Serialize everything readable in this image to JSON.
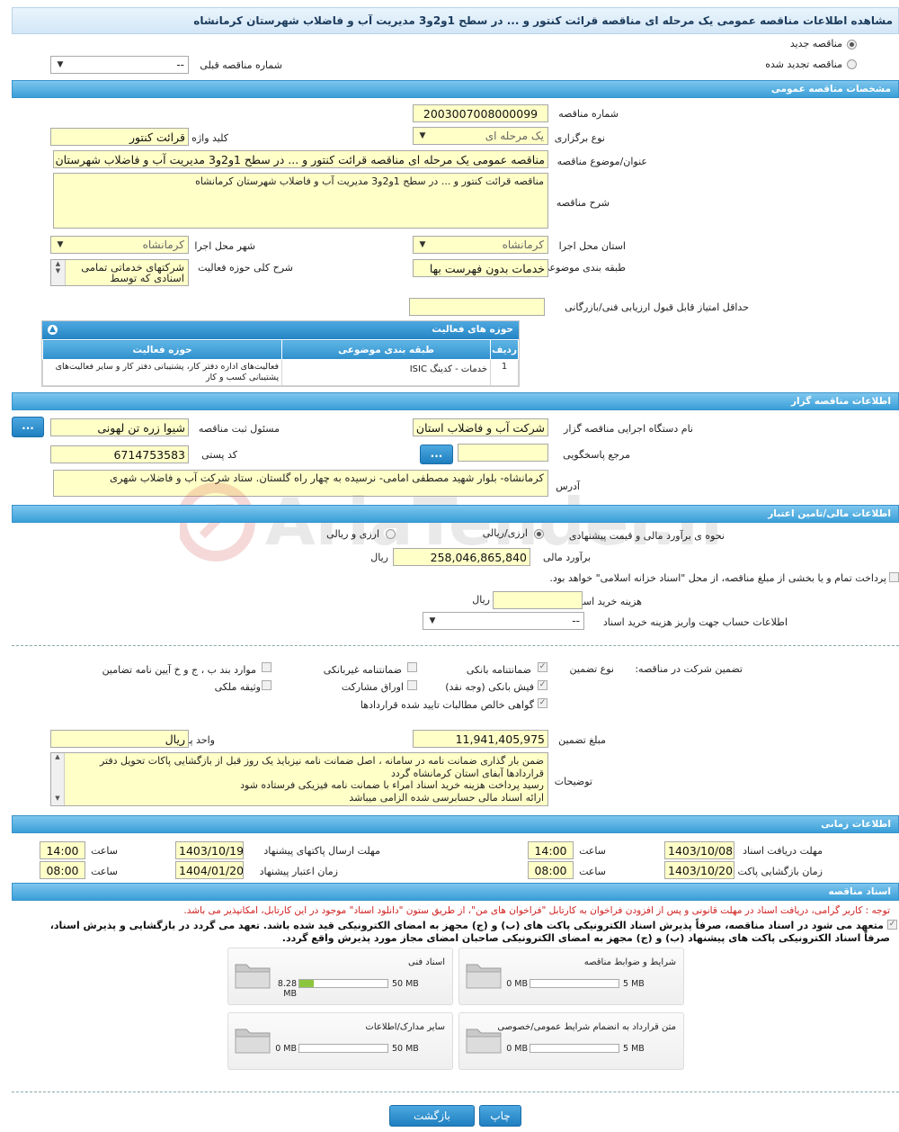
{
  "header": {
    "title": "مشاهده اطلاعات مناقصه عمومی یک مرحله ای مناقصه قرائت کنتور و ... در سطح 1و2و3 مدیریت آب و فاضلاب شهرستان کرمانشاه"
  },
  "top": {
    "radio_new": "مناقصه جدید",
    "radio_renew": "مناقصه تجدید شده",
    "prev_number_label": "شماره مناقصه قبلی",
    "prev_number_value": "--"
  },
  "sections": {
    "general": "مشخصات مناقصه عمومی",
    "organizer": "اطلاعات مناقصه گزار",
    "financial": "اطلاعات مالی/تامین اعتبار",
    "timing": "اطلاعات زمانی",
    "documents": "اسناد مناقصه"
  },
  "general": {
    "number_label": "شماره مناقصه",
    "number_value": "2003007008000099",
    "hold_type_label": "نوع برگزاری",
    "hold_type_value": "یک مرحله ای",
    "keyword_label": "کلید واژه",
    "keyword_value": "قرائت کنتور",
    "subject_label": "عنوان/موضوع مناقصه",
    "subject_value": "مناقصه عمومی یک مرحله ای مناقصه قرائت کنتور و ... در سطح 1و2و3 مدیریت آب و فاضلاب شهرستان کرمانشاه",
    "description_label": "شرح مناقصه",
    "description_value": "مناقصه قرائت کنتور و ... در سطح 1و2و3 مدیریت آب و فاضلاب شهرستان کرمانشاه",
    "province_label": "استان محل اجرا",
    "province_value": "کرمانشاه",
    "city_label": "شهر محل اجرا",
    "city_value": "کرمانشاه",
    "category_label": "طبقه بندی موضوعی",
    "category_value": "خدمات بدون فهرست بها",
    "activity_desc_label": "شرح کلی حوزه فعالیت",
    "activity_desc_value": "شرکتهای خدماتی تمامی اسنادی که توسط",
    "min_score_label": "حداقل امتیاز قابل قبول ارزیابی فنی/بازرگانی",
    "min_score_value": ""
  },
  "activity_table": {
    "title": "حوزه های فعالیت",
    "headers": [
      "ردیف",
      "طبقه بندی موضوعی",
      "حوزه فعالیت"
    ],
    "rows": [
      [
        "1",
        "خدمات - کدینگ ISIC",
        "فعالیت‌های  اداره دفتر کار، پشتیبانی دفتر کار و سایر فعالیت‌های پشتیبانی کسب و کار"
      ]
    ]
  },
  "organizer": {
    "agency_label": "نام دستگاه اجرایی مناقصه گزار",
    "agency_value": "شرکت آب و فاضلاب استان",
    "registrar_label": "مسئول ثبت مناقصه",
    "registrar_value": "شیوا زره تن لهونی",
    "more_button": "...",
    "responder_label": "مرجع پاسخگویی",
    "responder_value": "",
    "postal_label": "کد پستی",
    "postal_value": "6714753583",
    "address_label": "آدرس",
    "address_value": "کرمانشاه- بلوار شهید مصطفی امامی- نرسیده به چهار راه گلستان. ستاد شرکت  آب و فاضلاب شهری"
  },
  "financial": {
    "estimate_method_label": "نحوه ی برآورد مالی و قیمت پیشنهادی",
    "opt_rial_currency": "ارزی/ریالی",
    "opt_currency_and_rial": "ارزی و ریالی",
    "estimate_label": "برآورد مالی",
    "estimate_value": "258,046,865,840",
    "currency_rial": "ریال",
    "treasury_text": "پرداخت تمام و یا بخشی از مبلغ مناقصه، از محل \"اسناد خزانه اسلامی\" خواهد بود.",
    "doc_fee_label": "هزینه خرید اسناد",
    "doc_fee_value": "",
    "account_label": "اطلاعات حساب جهت واریز هزینه خرید اسناد",
    "account_value": "--",
    "guarantee_section_label": "تضمین شرکت در مناقصه:",
    "guarantee_type_label": "نوع تضمین",
    "guarantees": [
      {
        "label": "ضمانتنامه بانکی",
        "checked": true
      },
      {
        "label": "ضمانتنامه غیربانکی",
        "checked": false
      },
      {
        "label": "موارد بند ب ، ج و خ آیین نامه تضامین",
        "checked": false
      },
      {
        "label": "فیش بانکی (وجه نقد)",
        "checked": true
      },
      {
        "label": "اوراق مشارکت",
        "checked": false
      },
      {
        "label": "وثیقه ملکی",
        "checked": false
      },
      {
        "label": "گواهی خالص مطالبات تایید شده قراردادها",
        "checked": true
      }
    ],
    "guarantee_amount_label": "مبلغ تضمین",
    "guarantee_amount_value": "11,941,405,975",
    "money_unit_label": "واحد پول",
    "money_unit_value": "ریال",
    "notes_label": "توضیحات",
    "notes_lines": [
      "ضمن بار گذاری ضمانت نامه در سامانه ، اصل ضمانت نامه نیزبایذ یک روز قبل از بازگشایی پاکات تحویل دفتر قراردادها آبفای استان کرمانشاه گردد",
      " رسید پرداخت هزینه خرید اسناد امراء با ضمانت نامه فیزیکی فرستاده شود",
      "ارائه اسناد مالی حسابرسی شده الزامی میباشد"
    ]
  },
  "timing": {
    "doc_receive_deadline_label": "مهلت دریافت اسناد",
    "doc_receive_deadline_date": "1403/10/08",
    "doc_receive_deadline_time": "14:00",
    "submit_deadline_label": "مهلت ارسال پاکتهای پیشنهاد",
    "submit_deadline_date": "1403/10/19",
    "submit_deadline_time": "14:00",
    "opening_label": "زمان بازگشایی پاکت ها",
    "opening_date": "1403/10/20",
    "opening_time": "08:00",
    "validity_label": "زمان اعتبار پیشنهاد",
    "validity_date": "1404/01/20",
    "validity_time": "08:00",
    "time_label": "ساعت"
  },
  "documents": {
    "red_notice": "توجه : کاربر گرامی، دریافت اسناد در مهلت قانونی و پس از افزودن فراخوان به کارتابل \"فراخوان های من\"، از طریق ستون \"دانلود اسناد\" موجود در این کارتابل، امکانپذیر می باشد.",
    "commitment_line1": "متعهد می شود در اسناد مناقصه، صرفاً پذیرش اسناد الکترونیکی پاکت های (ب) و (ج) مجهز به امضای الکترونیکی قید شده باشد. تعهد می گردد در بازگشایی و پذیرش اسناد،",
    "commitment_line2": "صرفاً اسناد الکترونیکی پاکت های پیشنهاد (ب) و (ج) مجهز به امضای الکترونیکی صاحبان امضای مجاز مورد پذیرش واقع گردد.",
    "files": [
      {
        "name": "شرایط و ضوابط مناقصه",
        "min": "0 MB",
        "max": "5 MB",
        "used": 0.0
      },
      {
        "name": "اسناد فنی",
        "min": "8.28 MB",
        "max": "50 MB",
        "used": 0.166
      },
      {
        "name": "متن قرارداد به انضمام شرایط عمومی/خصوصی",
        "min": "0 MB",
        "max": "5 MB",
        "used": 0.0
      },
      {
        "name": "سایر مدارک/اطلاعات",
        "min": "0 MB",
        "max": "50 MB",
        "used": 0.0
      }
    ]
  },
  "footer": {
    "back_button": "بازگشت",
    "print_button": "چاپ"
  },
  "watermark": {
    "text": "AriaTender.neT"
  },
  "colors": {
    "section_bar": "#3a9fd8",
    "field_bg": "#ffffc8",
    "button_blue": "#1f7fc0",
    "notice_red": "#d02020"
  }
}
